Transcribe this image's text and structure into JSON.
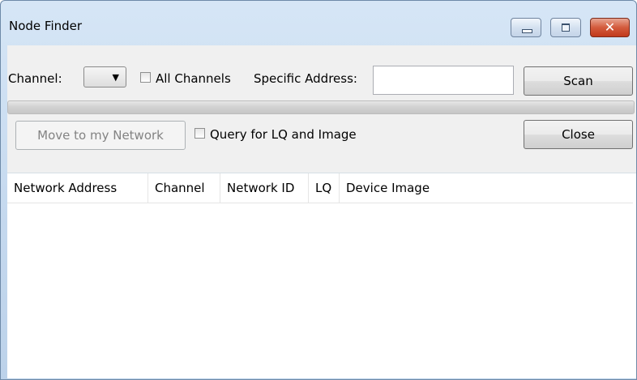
{
  "window": {
    "title": "Node Finder",
    "controls": {
      "minimize": "",
      "maximize": "",
      "close": "✕"
    }
  },
  "toolbar": {
    "channel_label": "Channel:",
    "channel_value": "",
    "all_channels_label": "All Channels",
    "all_channels_checked": false,
    "specific_address_label": "Specific Address:",
    "specific_address_value": "",
    "scan_label": "Scan",
    "move_label": "Move to my Network",
    "query_label": "Query for LQ and Image",
    "query_checked": false,
    "close_label": "Close"
  },
  "progress": {
    "value": 0
  },
  "table": {
    "columns": [
      "Network Address",
      "Channel",
      "Network ID",
      "LQ",
      "Device Image"
    ],
    "rows": []
  }
}
